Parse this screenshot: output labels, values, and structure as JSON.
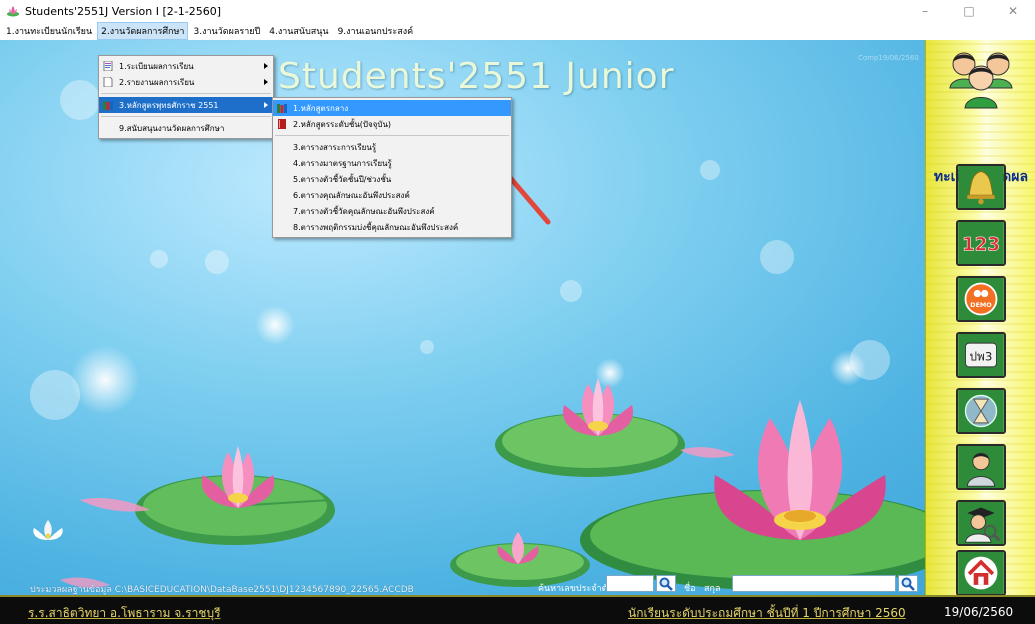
{
  "window": {
    "title": "Students'2551J Version I [2-1-2560]",
    "minimize_glyph": "–",
    "maximize_glyph": "□",
    "close_glyph": "✕"
  },
  "menubar": {
    "items": [
      {
        "label": "1.งานทะเบียนนักเรียน"
      },
      {
        "label": "2.งานวัดผลการศึกษา"
      },
      {
        "label": "3.งานวัดผลรายปี"
      },
      {
        "label": "4.งานสนับสนุน"
      },
      {
        "label": "9.งานเอนกประสงค์"
      }
    ]
  },
  "menu_level1": {
    "items": [
      {
        "label": "1.ระเบียนผลการเรียน",
        "icon": "document-icon"
      },
      {
        "label": "2.รายงานผลการเรียน",
        "icon": "page-icon"
      },
      {
        "label": "3.หลักสูตรพุทธศักราช 2551",
        "icon": "books-icon"
      },
      {
        "label": "9.สนับสนุนงานวัดผลการศึกษา",
        "icon": ""
      }
    ]
  },
  "menu_level2": {
    "items": [
      {
        "label": "1.หลักสูตรกลาง",
        "icon": "books-icon"
      },
      {
        "label": "2.หลักสูตรระดับชั้น(ปัจจุบัน)",
        "icon": "red-book-icon"
      },
      {
        "label": "3.ตารางสาระการเรียนรู้"
      },
      {
        "label": "4.ตารางมาตรฐานการเรียนรู้"
      },
      {
        "label": "5.ตารางตัวชี้วัดชั้นปี/ช่วงชั้น"
      },
      {
        "label": "6.ตารางคุณลักษณะอันพึงประสงค์"
      },
      {
        "label": "7.ตารางตัวชี้วัดคุณลักษณะอันพึงประสงค์"
      },
      {
        "label": "8.ตารางพฤติกรรมบ่งชี้คุณลักษณะอันพึงประสงค์"
      }
    ]
  },
  "main": {
    "app_title": "Students'2551 Junior",
    "watermark": "Comp19/06/2560",
    "db_path": "ประมวลผลฐานข้อมูล C:\\BASICEDUCATION\\DataBase2551\\DJ1234567890_22565.ACCDB",
    "search_id_label": "ค้นหาเลขประจำตัว",
    "search_id_value": "",
    "name_label": "ชื่อ",
    "surname_label": "สกุล",
    "name_value": ""
  },
  "side_panel": {
    "label": "ทะเบียน&วัดผล",
    "buttons": [
      {
        "name": "bell-button",
        "icon": "bell-icon"
      },
      {
        "name": "numbers-button",
        "icon": "123-icon",
        "text": "123"
      },
      {
        "name": "demo-button",
        "icon": "demo-icon",
        "text": "DEMO"
      },
      {
        "name": "pw3-button",
        "icon": "pw3-icon",
        "text": "ปพ3"
      },
      {
        "name": "hourglass-button",
        "icon": "hourglass-icon"
      },
      {
        "name": "person-button",
        "icon": "person-icon"
      },
      {
        "name": "graduate-search-button",
        "icon": "graduate-search-icon"
      },
      {
        "name": "home-button",
        "icon": "home-icon"
      }
    ]
  },
  "statusbar": {
    "school": "ร.ร.สาธิตวิทยา  อ.โพธาราม  จ.ราชบุรี",
    "level": "นักเรียนระดับประถมศึกษา  ชั้นปีที่ 1  ปีการศึกษา 2560",
    "date": "19/06/2560"
  },
  "colors": {
    "menu_highlight": "#3399ff",
    "side_label": "#0b2e8a",
    "status_text": "#e5d66b",
    "status_bg": "#0c0c0c",
    "arrow": "#e2473c"
  }
}
